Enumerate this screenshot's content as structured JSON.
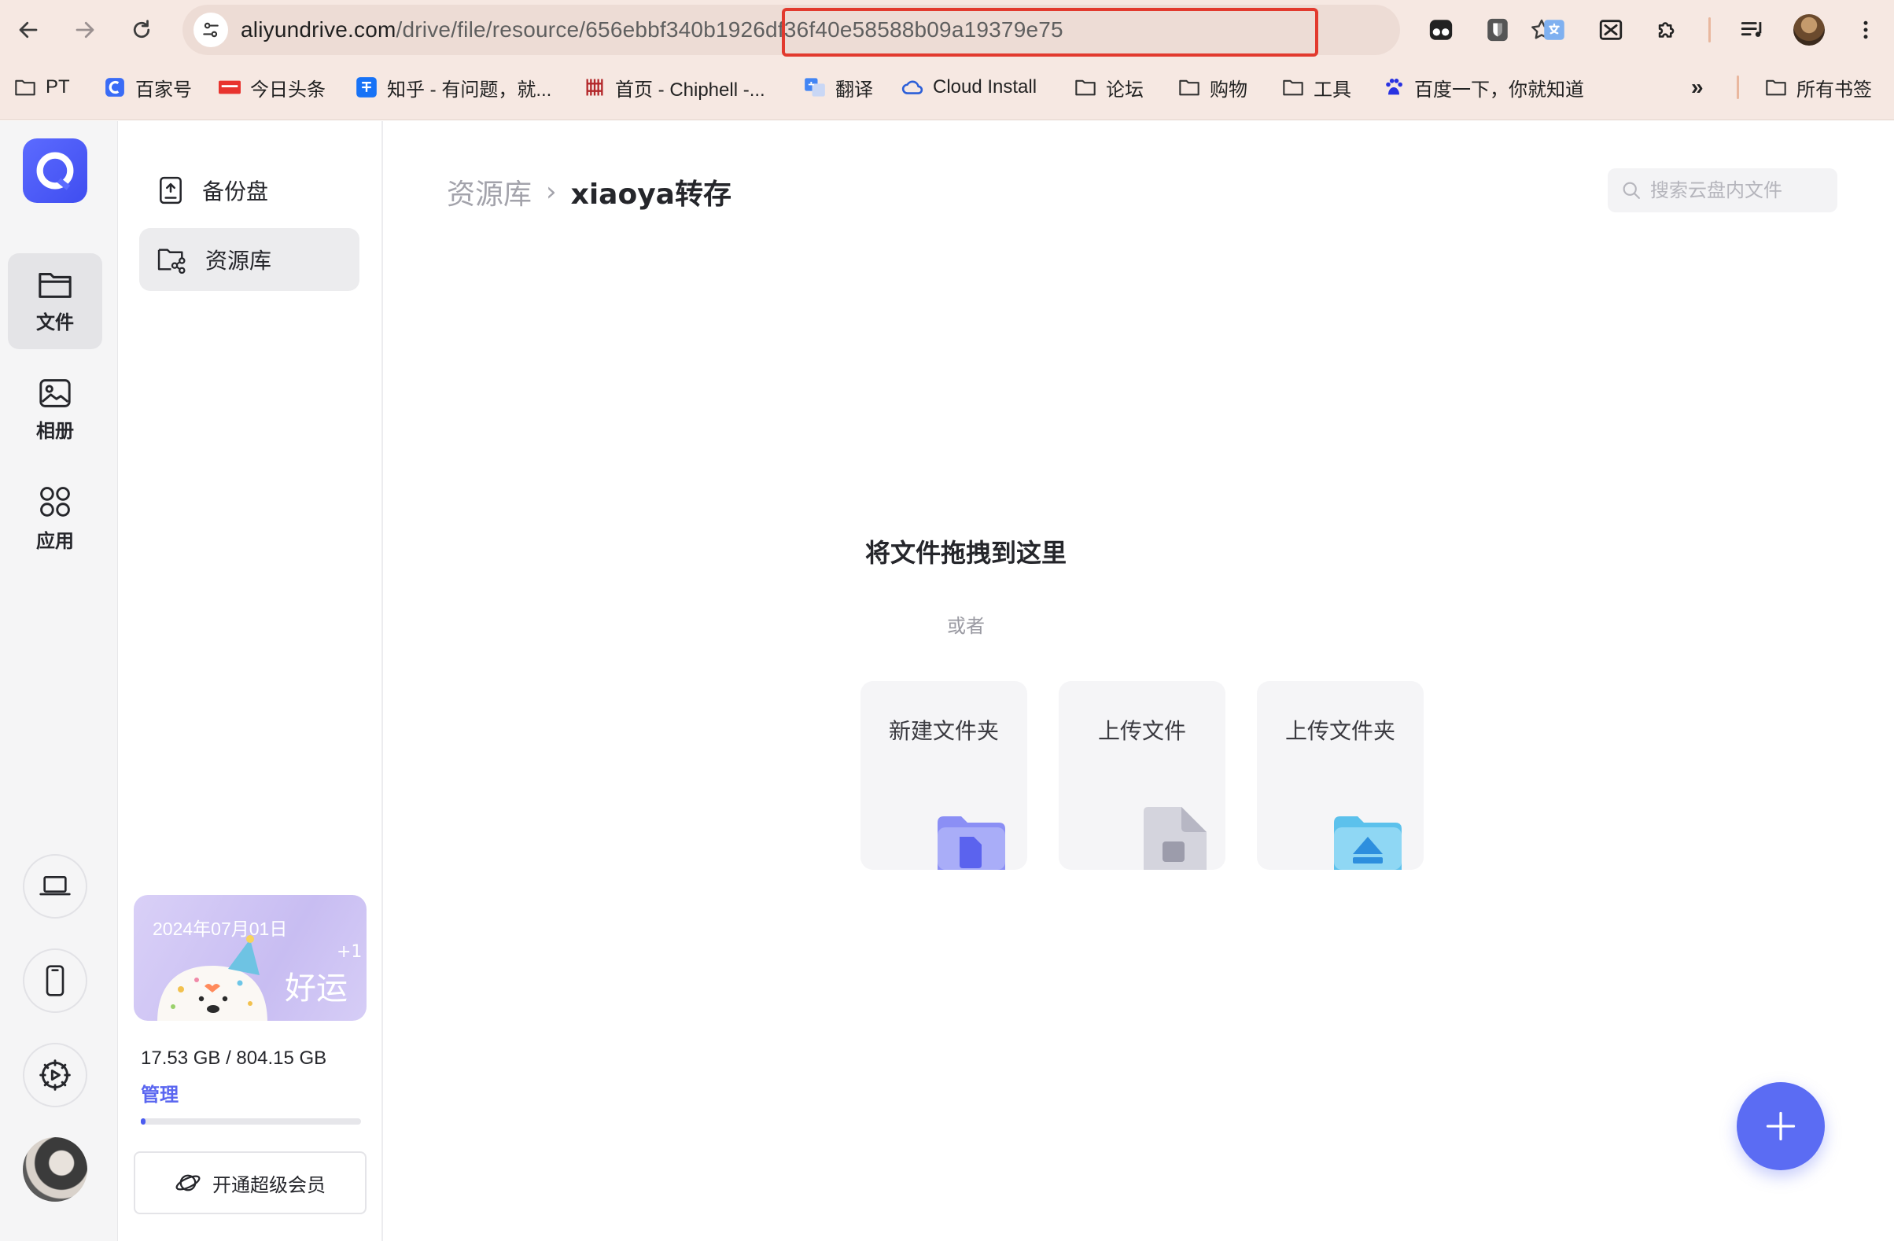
{
  "browser": {
    "url_host": "aliyundrive.com",
    "url_path": "/drive/file/resource/656ebbf340b1926df36f40e58588b09a19379e75",
    "bookmarks": [
      {
        "label": "PT",
        "icon": "folder-icon"
      },
      {
        "label": "百家号",
        "icon": "baijiahao-icon"
      },
      {
        "label": "今日头条",
        "icon": "toutiao-icon"
      },
      {
        "label": "知乎 - 有问题，就...",
        "icon": "zhihu-icon"
      },
      {
        "label": "首页 - Chiphell -...",
        "icon": "chiphell-icon"
      },
      {
        "label": "翻译",
        "icon": "translate-icon"
      },
      {
        "label": "Cloud Install",
        "icon": "cloud-icon"
      },
      {
        "label": "论坛",
        "icon": "folder-icon"
      },
      {
        "label": "购物",
        "icon": "folder-icon"
      },
      {
        "label": "工具",
        "icon": "folder-icon"
      },
      {
        "label": "百度一下，你就知道",
        "icon": "baidu-icon"
      }
    ],
    "overflow": "»",
    "all_bookmarks": "所有书签"
  },
  "rail": {
    "items": [
      {
        "label": "文件",
        "icon": "folder-icon",
        "active": true
      },
      {
        "label": "相册",
        "icon": "photo-icon",
        "active": false
      },
      {
        "label": "应用",
        "icon": "apps-icon",
        "active": false
      }
    ],
    "bottom_icons": [
      "laptop-icon",
      "phone-icon",
      "settings-icon"
    ]
  },
  "sidebar": {
    "items": [
      {
        "label": "备份盘",
        "icon": "backup-drive-icon",
        "active": false
      },
      {
        "label": "资源库",
        "icon": "resource-folder-icon",
        "active": true
      }
    ],
    "promo": {
      "date": "2024年07月01日",
      "plus": "+1",
      "luck": "好运"
    },
    "storage": {
      "used_total": "17.53 GB / 804.15 GB",
      "manage": "管理",
      "fraction_used": 0.022
    },
    "vip_label": "开通超级会员"
  },
  "main": {
    "breadcrumb": {
      "parent": "资源库",
      "separator": "›",
      "current": "xiaoya转存"
    },
    "search_placeholder": "搜索云盘内文件",
    "drop_title": "将文件拖拽到这里",
    "drop_or": "或者",
    "cards": [
      {
        "label": "新建文件夹",
        "icon": "new-folder-icon"
      },
      {
        "label": "上传文件",
        "icon": "upload-file-icon"
      },
      {
        "label": "上传文件夹",
        "icon": "upload-folder-icon"
      }
    ],
    "fab_icon": "plus-icon"
  },
  "colors": {
    "accent": "#5b6cf3",
    "chrome_bg": "#f6e8e2",
    "highlight_box": "#e23a2e"
  }
}
